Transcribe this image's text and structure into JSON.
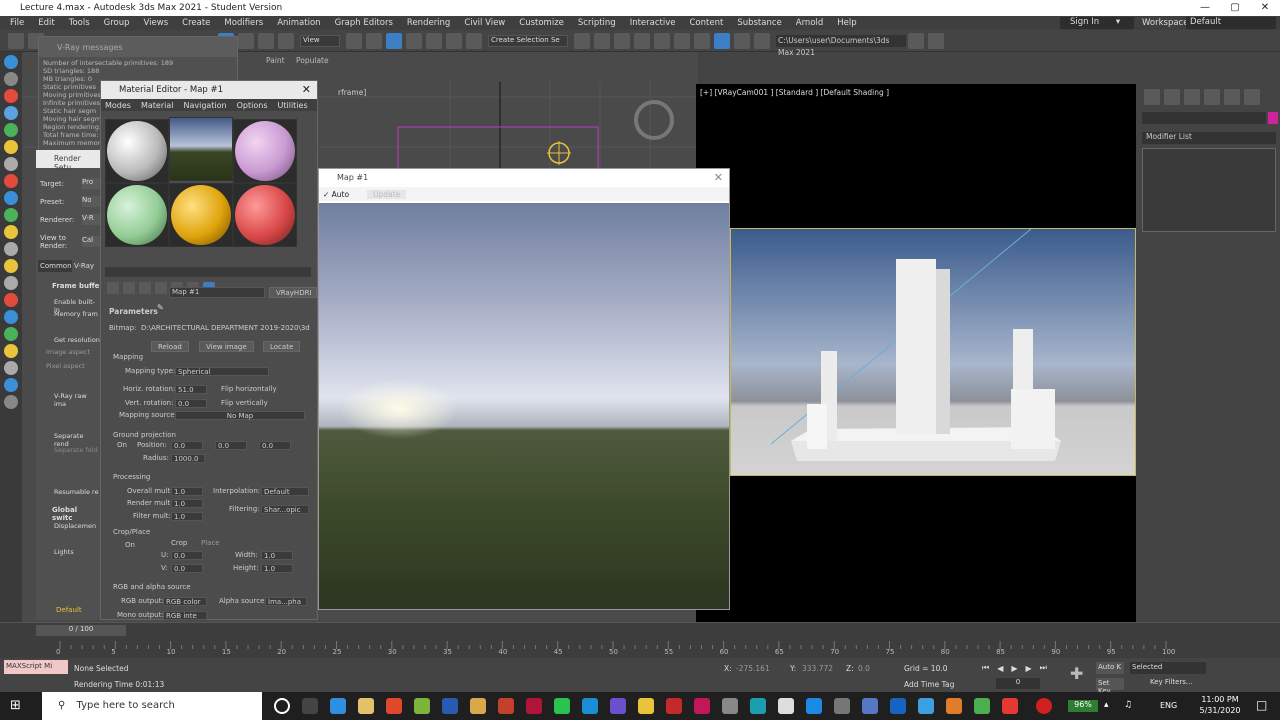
{
  "window": {
    "title": "Lecture 4.max - Autodesk 3ds Max 2021 - Student Version"
  },
  "menu": [
    "File",
    "Edit",
    "Tools",
    "Group",
    "Views",
    "Create",
    "Modifiers",
    "Animation",
    "Graph Editors",
    "Rendering",
    "Civil View",
    "Customize",
    "Scripting",
    "Interactive",
    "Content",
    "Substance",
    "Arnold",
    "Help"
  ],
  "account": {
    "signin": "Sign In",
    "workspaces_label": "Workspaces:",
    "workspace": "Default"
  },
  "toolbar": {
    "view_select": "View",
    "selection_set": "Create Selection Se",
    "path": "C:\\Users\\user\\Documents\\3ds Max 2021"
  },
  "vray_messages": {
    "title": "V-Ray messages",
    "lines": [
      "Number of intersectable primitives: 189",
      "SD triangles: 188",
      "MB triangles: 0",
      "Static primitives",
      "Moving primitives",
      "Infinite primitives",
      "Static hair segm",
      "Moving hair segm",
      "Region rendering:",
      "Total frame time:",
      "Maximum memory"
    ]
  },
  "render_setup": {
    "title": "Render Setu",
    "target_label": "Target:",
    "target_value": "Pro",
    "preset_label": "Preset:",
    "preset_value": "No",
    "renderer_label": "Renderer:",
    "renderer_value": "V-R",
    "view_label": "View to Render:",
    "view_value": "Cal",
    "tab_common": "Common",
    "tab_vray": "V-Ray",
    "frame_buffer": "Frame buffe",
    "enable_builtin": "Enable built-in",
    "memory_frame": "Memory fram",
    "get_resolution": "Get resolution",
    "image_aspect": "Image aspect",
    "pixel_aspect": "Pixel aspect",
    "vray_raw": "V-Ray raw ima",
    "separate_render": "Separate rend",
    "separate_folder": "Separate fold",
    "resumable": "Resumable re",
    "global_switches": "Global switc",
    "displacement": "Displacemen",
    "lights": "Lights",
    "default": "Default"
  },
  "material_editor": {
    "title": "Material Editor - Map #1",
    "menu": [
      "Modes",
      "Material",
      "Navigation",
      "Options",
      "Utilities"
    ],
    "map_name": "Map #1",
    "map_type": "VRayHDRI",
    "parameters": "Parameters",
    "bitmap_label": "Bitmap:",
    "bitmap_path": "D:\\ARCHITECTURAL DEPARTMENT 2019-2020\\3d",
    "reload": "Reload",
    "view_image": "View image",
    "locate": "Locate",
    "mapping": "Mapping",
    "mapping_type_label": "Mapping type:",
    "mapping_type": "Spherical",
    "horiz_rot_label": "Horiz. rotation:",
    "horiz_rot": "51.0",
    "flip_h": "Flip horizontally",
    "vert_rot_label": "Vert. rotation:",
    "vert_rot": "0.0",
    "flip_v": "Flip vertically",
    "mapping_source_label": "Mapping source:",
    "mapping_source": "No Map",
    "ground_proj": "Ground projection",
    "on": "On",
    "position_label": "Position:",
    "pos": [
      "0.0",
      "0.0",
      "0.0"
    ],
    "radius_label": "Radius:",
    "radius": "1000.0",
    "processing": "Processing",
    "overall_label": "Overall mult:",
    "overall": "1.0",
    "interp_label": "Interpolation:",
    "interp": "Default",
    "render_mult_label": "Render mult:",
    "render_mult": "1.0",
    "filtering_label": "Filtering:",
    "filtering": "Shar...opic",
    "filter_mult_label": "Filter mult:",
    "filter_mult": "1.0",
    "crop_place": "Crop/Place",
    "crop": "Crop",
    "place": "Place",
    "u_label": "U:",
    "u": "0.0",
    "v_label": "V:",
    "v": "0.0",
    "width_label": "Width:",
    "width": "1.0",
    "height_label": "Height:",
    "height": "1.0",
    "rgb_alpha": "RGB and alpha source",
    "rgb_out_label": "RGB output:",
    "rgb_out": "RGB color",
    "alpha_src_label": "Alpha source:",
    "alpha_src": "Ima...pha",
    "mono_out_label": "Mono output:",
    "mono_out": "RGB inte"
  },
  "map_window": {
    "title": "Map #1",
    "auto": "Auto",
    "update": "Update"
  },
  "viewport_left": {
    "label": "[+] [Top] [Standard] [Wireframe]",
    "label_visible": "rframe]"
  },
  "viewport_right": {
    "label": "[+] [VRayCam001 ] [Standard ] [Default Shading ]"
  },
  "command_panel": {
    "modifier_list": "Modifier List",
    "tab_paint": "Paint",
    "tab_populate": "Populate"
  },
  "timeline": {
    "frame": "0 / 100",
    "ticks": [
      "0",
      "5",
      "10",
      "15",
      "20",
      "25",
      "30",
      "35",
      "40",
      "45",
      "50",
      "55",
      "60",
      "65",
      "70",
      "75",
      "80",
      "85",
      "90",
      "95",
      "100"
    ]
  },
  "status": {
    "maxscript": "MAXScript Mi",
    "selection": "None Selected",
    "render_time": "Rendering Time  0:01:13",
    "x_label": "X:",
    "x": "-275.161",
    "y_label": "Y:",
    "y": "333.772",
    "z_label": "Z:",
    "z": "0.0",
    "grid": "Grid = 10.0",
    "add_time_tag": "Add Time Tag",
    "auto_key": "Auto K",
    "selected": "Selected",
    "set_key": "Set Key",
    "key_filters": "Key Filters...",
    "frame_spinner": "0"
  },
  "taskbar": {
    "search": "Type here to search",
    "battery": "96%",
    "lang": "ENG",
    "time": "11:00 PM",
    "date": "5/31/2020"
  }
}
